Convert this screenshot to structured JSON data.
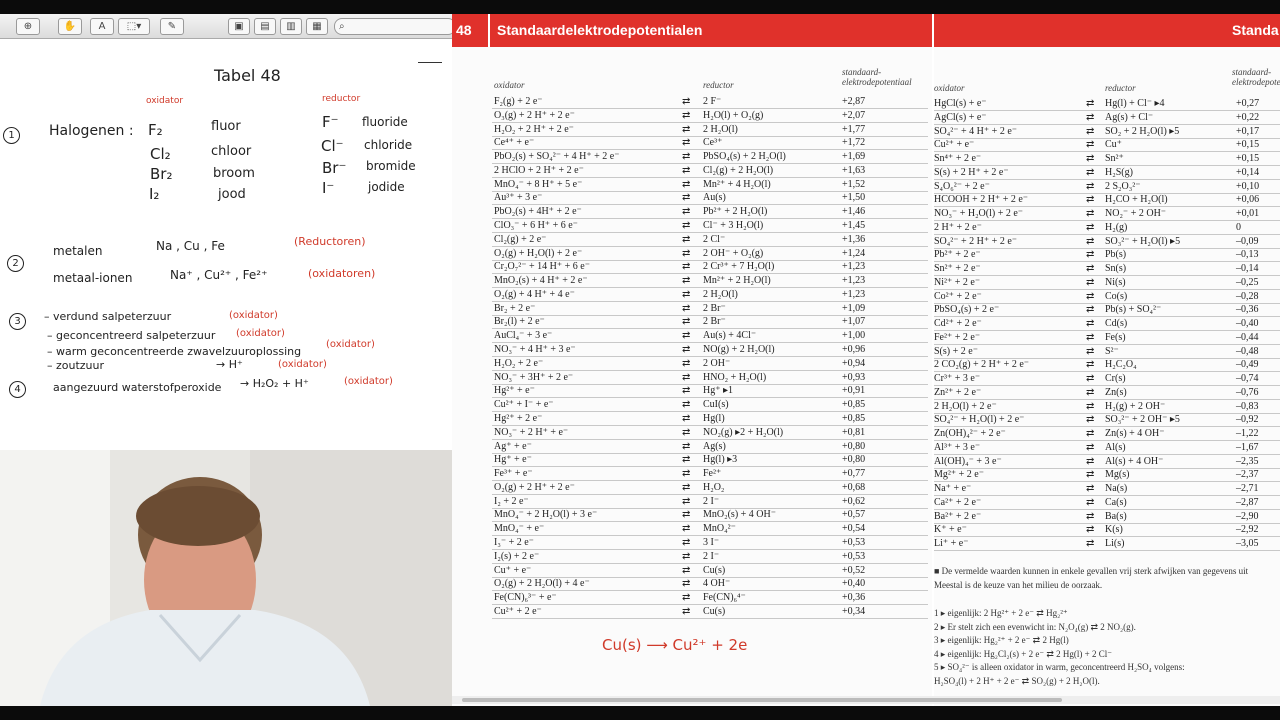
{
  "notes": {
    "title": "Tabel 48",
    "col_oxidator": "oxidator",
    "col_reductor": "reductor",
    "items": {
      "n1": "1",
      "n2": "2",
      "n3": "3",
      "n4": "4",
      "halogenen": "Halogenen :",
      "f2": "F₂",
      "fluor": "fluor",
      "cl2": "Cl₂",
      "chloor": "chloor",
      "br2": "Br₂",
      "broom": "broom",
      "i2": "I₂",
      "jood": "jood",
      "fmin": "F⁻",
      "fluoride": "fluoride",
      "clmin": "Cl⁻",
      "chloride": "chloride",
      "brmin": "Br⁻",
      "bromide": "bromide",
      "imin": "I⁻",
      "jodide": "jodide",
      "metalen": "metalen",
      "metalen_list": "Na , Cu , Fe",
      "reductoren": "(Reductoren)",
      "metaalionen": "metaal-ionen",
      "ionen_list": "Na⁺ , Cu²⁺ , Fe²⁺",
      "oxidatoren": "(oxidatoren)",
      "l3a": "– verdund salpeterzuur",
      "l3a_r": "(oxidator)",
      "l3b": "– geconcentreerd salpeterzuur",
      "l3b_r": "(oxidator)",
      "l3c": "– warm geconcentreerde zwavelzuuroplossing",
      "l3c_r": "(oxidator)",
      "l3d": "– zoutzuur",
      "l3d_arrow": "→ H⁺",
      "l3d_r": "(oxidator)",
      "l4": "aangezuurd waterstofperoxide",
      "l4_arrow": "→ H₂O₂ + H⁺",
      "l4_r": "(oxidator)"
    }
  },
  "toolbar": {
    "zoom_icon": "zoom-icon",
    "hand_icon": "hand-icon",
    "text_icon": "text-icon",
    "select_icon": "select-icon",
    "pen_icon": "pen-icon",
    "view1": "view-single-icon",
    "view2": "view-double-icon",
    "view3": "view-grid-icon",
    "view4": "view-list-icon",
    "search_icon": "search-icon"
  },
  "page": {
    "number": "48",
    "title": "Standaardelektrodepotentialen",
    "title_right": "Standa",
    "colors": {
      "header": "#e0312b"
    },
    "left_headers": {
      "ox": "oxidator",
      "red": "reductor",
      "pot": "standaard-elektrodepotentiaal"
    },
    "right_headers": {
      "ox": "oxidator",
      "red": "reductor",
      "pot": "standaard-elektrodepotentiaal"
    },
    "left_rows": [
      [
        "F₂(g) + 2 e⁻",
        "⇄",
        "2 F⁻",
        "+2,87"
      ],
      [
        "O₃(g) + 2 H⁺ + 2 e⁻",
        "⇄",
        "H₂O(l) + O₂(g)",
        "+2,07"
      ],
      [
        "H₂O₂ + 2 H⁺ + 2 e⁻",
        "⇄",
        "2 H₂O(l)",
        "+1,77"
      ],
      [
        "Ce⁴⁺ + e⁻",
        "⇄",
        "Ce³⁺",
        "+1,72"
      ],
      [
        "PbO₂(s) + SO₄²⁻ + 4 H⁺ + 2 e⁻",
        "⇄",
        "PbSO₄(s) + 2 H₂O(l)",
        "+1,69"
      ],
      [
        "2 HClO + 2 H⁺ + 2 e⁻",
        "⇄",
        "Cl₂(g) + 2 H₂O(l)",
        "+1,63"
      ],
      [
        "MnO₄⁻ + 8 H⁺ + 5 e⁻",
        "⇄",
        "Mn²⁺ + 4 H₂O(l)",
        "+1,52"
      ],
      [
        "Au³⁺ + 3 e⁻",
        "⇄",
        "Au(s)",
        "+1,50"
      ],
      [
        "PbO₂(s) + 4H⁺ + 2 e⁻",
        "⇄",
        "Pb²⁺ + 2 H₂O(l)",
        "+1,46"
      ],
      [
        "ClO₃⁻ + 6 H⁺ + 6 e⁻",
        "⇄",
        "Cl⁻ + 3 H₂O(l)",
        "+1,45"
      ],
      [
        "Cl₂(g) + 2 e⁻",
        "⇄",
        "2 Cl⁻",
        "+1,36"
      ],
      [
        "O₂(g) + H₂O(l) + 2 e⁻",
        "⇄",
        "2 OH⁻ + O₂(g)",
        "+1,24"
      ],
      [
        "Cr₂O₇²⁻ + 14 H⁺ + 6 e⁻",
        "⇄",
        "2 Cr³⁺ + 7 H₂O(l)",
        "+1,23"
      ],
      [
        "MnO₂(s) + 4 H⁺ + 2 e⁻",
        "⇄",
        "Mn²⁺ + 2 H₂O(l)",
        "+1,23"
      ],
      [
        "O₂(g) + 4 H⁺ + 4 e⁻",
        "⇄",
        "2 H₂O(l)",
        "+1,23"
      ],
      [
        "Br₂ + 2 e⁻",
        "⇄",
        "2 Br⁻",
        "+1,09"
      ],
      [
        "Br₂(l) + 2 e⁻",
        "⇄",
        "2 Br⁻",
        "+1,07"
      ],
      [
        "AuCl₄⁻ + 3 e⁻",
        "⇄",
        "Au(s) + 4Cl⁻",
        "+1,00"
      ],
      [
        "NO₃⁻ + 4 H⁺ + 3 e⁻",
        "⇄",
        "NO(g) + 2 H₂O(l)",
        "+0,96"
      ],
      [
        "H₂O₂ + 2 e⁻",
        "⇄",
        "2 OH⁻",
        "+0,94"
      ],
      [
        "NO₃⁻ + 3H⁺ + 2 e⁻",
        "⇄",
        "HNO₂ + H₂O(l)",
        "+0,93"
      ],
      [
        "Hg²⁺ + e⁻",
        "⇄",
        "Hg⁺ ▸1",
        "+0,91"
      ],
      [
        "Cu²⁺ + I⁻ + e⁻",
        "⇄",
        "CuI(s)",
        "+0,85"
      ],
      [
        "Hg²⁺ + 2 e⁻",
        "⇄",
        "Hg(l)",
        "+0,85"
      ],
      [
        "NO₃⁻ + 2 H⁺ + e⁻",
        "⇄",
        "NO₂(g) ▸2 + H₂O(l)",
        "+0,81"
      ],
      [
        "Ag⁺ + e⁻",
        "⇄",
        "Ag(s)",
        "+0,80"
      ],
      [
        "Hg⁺ + e⁻",
        "⇄",
        "Hg(l) ▸3",
        "+0,80"
      ],
      [
        "Fe³⁺ + e⁻",
        "⇄",
        "Fe²⁺",
        "+0,77"
      ],
      [
        "O₂(g) + 2 H⁺ + 2 e⁻",
        "⇄",
        "H₂O₂",
        "+0,68"
      ],
      [
        "I₂ + 2 e⁻",
        "⇄",
        "2 I⁻",
        "+0,62"
      ],
      [
        "MnO₄⁻ + 2 H₂O(l) + 3 e⁻",
        "⇄",
        "MnO₂(s) + 4 OH⁻",
        "+0,57"
      ],
      [
        "MnO₄⁻ + e⁻",
        "⇄",
        "MnO₄²⁻",
        "+0,54"
      ],
      [
        "I₃⁻ + 2 e⁻",
        "⇄",
        "3 I⁻",
        "+0,53"
      ],
      [
        "I₂(s) + 2 e⁻",
        "⇄",
        "2 I⁻",
        "+0,53"
      ],
      [
        "Cu⁺ + e⁻",
        "⇄",
        "Cu(s)",
        "+0,52"
      ],
      [
        "O₂(g) + 2 H₂O(l) + 4 e⁻",
        "⇄",
        "4 OH⁻",
        "+0,40"
      ],
      [
        "Fe(CN)₆³⁻ + e⁻",
        "⇄",
        "Fe(CN)₆⁴⁻",
        "+0,36"
      ],
      [
        "Cu²⁺ + 2 e⁻",
        "⇄",
        "Cu(s)",
        "+0,34"
      ]
    ],
    "right_rows": [
      [
        "HgCl(s) + e⁻",
        "⇄",
        "Hg(l) + Cl⁻ ▸4",
        "+0,27"
      ],
      [
        "AgCl(s) + e⁻",
        "⇄",
        "Ag(s) + Cl⁻",
        "+0,22"
      ],
      [
        "SO₄²⁻ + 4 H⁺ + 2 e⁻",
        "⇄",
        "SO₂ + 2 H₂O(l) ▸5",
        "+0,17"
      ],
      [
        "Cu²⁺ + e⁻",
        "⇄",
        "Cu⁺",
        "+0,15"
      ],
      [
        "Sn⁴⁺ + 2 e⁻",
        "⇄",
        "Sn²⁺",
        "+0,15"
      ],
      [
        "S(s) + 2 H⁺ + 2 e⁻",
        "⇄",
        "H₂S(g)",
        "+0,14"
      ],
      [
        "S₄O₆²⁻ + 2 e⁻",
        "⇄",
        "2 S₂O₃²⁻",
        "+0,10"
      ],
      [
        "HCOOH + 2 H⁺ + 2 e⁻",
        "⇄",
        "H₂CO + H₂O(l)",
        "+0,06"
      ],
      [
        "NO₃⁻ + H₂O(l) + 2 e⁻",
        "⇄",
        "NO₂⁻ + 2 OH⁻",
        "+0,01"
      ],
      [
        "2 H⁺ + 2 e⁻",
        "⇄",
        "H₂(g)",
        "0"
      ],
      [
        "SO₄²⁻ + 2 H⁺ + 2 e⁻",
        "⇄",
        "SO₃²⁻ + H₂O(l) ▸5",
        "–0,09"
      ],
      [
        "Pb²⁺ + 2 e⁻",
        "⇄",
        "Pb(s)",
        "–0,13"
      ],
      [
        "Sn²⁺ + 2 e⁻",
        "⇄",
        "Sn(s)",
        "–0,14"
      ],
      [
        "Ni²⁺ + 2 e⁻",
        "⇄",
        "Ni(s)",
        "–0,25"
      ],
      [
        "Co²⁺ + 2 e⁻",
        "⇄",
        "Co(s)",
        "–0,28"
      ],
      [
        "PbSO₄(s) + 2 e⁻",
        "⇄",
        "Pb(s) + SO₄²⁻",
        "–0,36"
      ],
      [
        "Cd²⁺ + 2 e⁻",
        "⇄",
        "Cd(s)",
        "–0,40"
      ],
      [
        "Fe²⁺ + 2 e⁻",
        "⇄",
        "Fe(s)",
        "–0,44"
      ],
      [
        "S(s) + 2 e⁻",
        "⇄",
        "S²⁻",
        "–0,48"
      ],
      [
        "2 CO₂(g) + 2 H⁺ + 2 e⁻",
        "⇄",
        "H₂C₂O₄",
        "–0,49"
      ],
      [
        "Cr³⁺ + 3 e⁻",
        "⇄",
        "Cr(s)",
        "–0,74"
      ],
      [
        "Zn²⁺ + 2 e⁻",
        "⇄",
        "Zn(s)",
        "–0,76"
      ],
      [
        "2 H₂O(l) + 2 e⁻",
        "⇄",
        "H₂(g) + 2 OH⁻",
        "–0,83"
      ],
      [
        "SO₄²⁻ + H₂O(l) + 2 e⁻",
        "⇄",
        "SO₃²⁻ + 2 OH⁻ ▸5",
        "–0,92"
      ],
      [
        "Zn(OH)₄²⁻ + 2 e⁻",
        "⇄",
        "Zn(s) + 4 OH⁻",
        "–1,22"
      ],
      [
        "Al³⁺ + 3 e⁻",
        "⇄",
        "Al(s)",
        "–1,67"
      ],
      [
        "Al(OH)₄⁻ + 3 e⁻",
        "⇄",
        "Al(s) + 4 OH⁻",
        "–2,35"
      ],
      [
        "Mg²⁺ + 2 e⁻",
        "⇄",
        "Mg(s)",
        "–2,37"
      ],
      [
        "Na⁺ + e⁻",
        "⇄",
        "Na(s)",
        "–2,71"
      ],
      [
        "Ca²⁺ + 2 e⁻",
        "⇄",
        "Ca(s)",
        "–2,87"
      ],
      [
        "Ba²⁺ + 2 e⁻",
        "⇄",
        "Ba(s)",
        "–2,90"
      ],
      [
        "K⁺ + e⁻",
        "⇄",
        "K(s)",
        "–2,92"
      ],
      [
        "Li⁺ + e⁻",
        "⇄",
        "Li(s)",
        "–3,05"
      ]
    ],
    "footnote_intro": "■ De vermelde waarden kunnen in enkele gevallen vrij sterk afwijken van gegevens uit",
    "footnote_intro2": "Meestal is de keuze van het milieu de oorzaak.",
    "footnotes": [
      "1 ▸ eigenlijk: 2 Hg²⁺ + 2 e⁻ ⇄ Hg₂²⁺",
      "2 ▸ Er stelt zich een evenwicht in: N₂O₄(g) ⇄ 2 NO₂(g).",
      "3 ▸ eigenlijk: Hg₂²⁺ + 2 e⁻ ⇄ 2 Hg(l)",
      "4 ▸ eigenlijk: Hg₂Cl₂(s) + 2 e⁻ ⇄ 2 Hg(l) + 2 Cl⁻",
      "5 ▸ SO₄²⁻ is alleen oxidator in warm, geconcentreerd H₂SO₄ volgens:",
      "H₂SO₄(l) + 2 H⁺ + 2 e⁻ ⇄ SO₂(g) + 2 H₂O(l)."
    ],
    "annotation": "Cu(s) ⟶ Cu²⁺ + 2e"
  }
}
